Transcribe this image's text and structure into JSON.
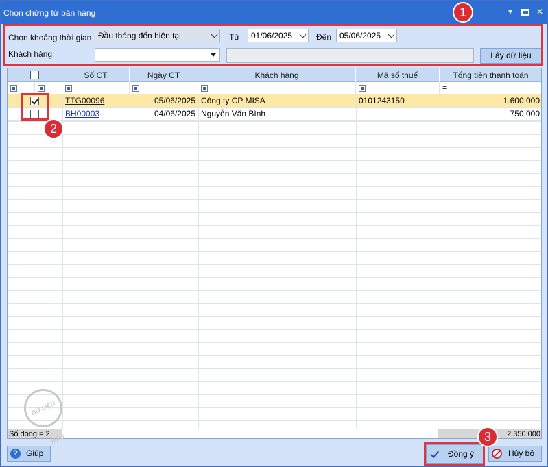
{
  "window": {
    "title": "Chọn chứng từ bán hàng"
  },
  "filter": {
    "period_label": "Chọn khoảng thời gian",
    "period_value": "Đầu tháng đến hiện tại",
    "from_label": "Từ",
    "from_value": "01/06/2025",
    "to_label": "Đến",
    "to_value": "05/06/2025",
    "customer_label": "Khách hàng",
    "customer_value": "",
    "fetch_button": "Lấy dữ liệu"
  },
  "grid": {
    "columns": [
      "Số CT",
      "Ngày CT",
      "Khách hàng",
      "Mã số thuế",
      "Tổng tiền thanh toán"
    ],
    "rows": [
      {
        "checked": true,
        "so_ct": "TTG00096",
        "ngay_ct": "05/06/2025",
        "khach_hang": "Công ty CP MISA",
        "ma_so_thue": "0101243150",
        "tong_tien": "1.600.000"
      },
      {
        "checked": false,
        "so_ct": "BH00003",
        "ngay_ct": "04/06/2025",
        "khach_hang": "Nguyễn Văn Bình",
        "ma_so_thue": "",
        "tong_tien": "750.000"
      }
    ],
    "row_count": "Số dòng = 2",
    "total": "2.350.000"
  },
  "watermark": "DỮ LIỆU MẪU",
  "buttons": {
    "help": "Giúp",
    "ok": "Đồng ý",
    "cancel": "Hủy bỏ"
  },
  "callouts": [
    "1",
    "2",
    "3"
  ],
  "colors": {
    "titlebar": "#2f6fd3",
    "selected_row": "#fde8a5",
    "highlight": "#e0343f"
  }
}
